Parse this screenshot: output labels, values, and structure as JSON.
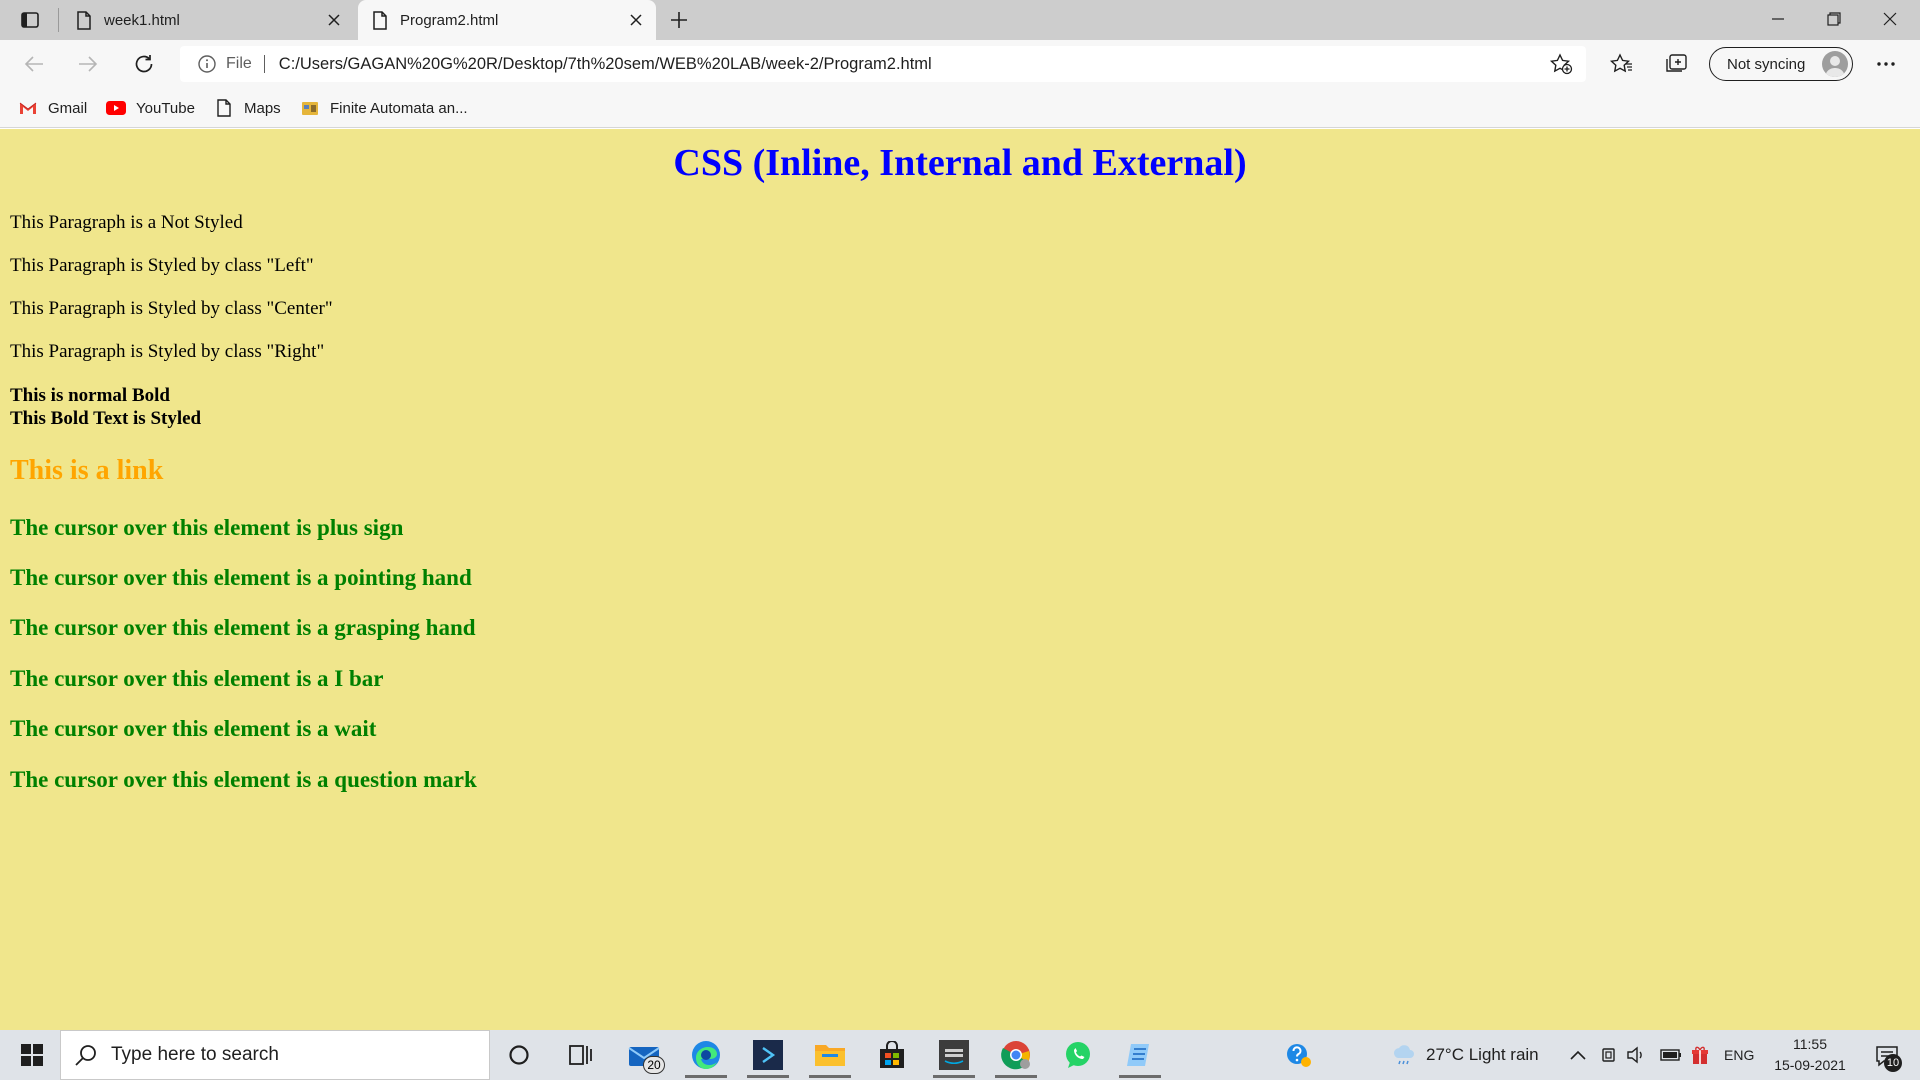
{
  "browser": {
    "tabs": [
      {
        "title": "week1.html",
        "active": false
      },
      {
        "title": "Program2.html",
        "active": true
      }
    ],
    "address": {
      "scheme_label": "File",
      "url": "C:/Users/GAGAN%20G%20R/Desktop/7th%20sem/WEB%20LAB/week-2/Program2.html"
    },
    "profile_label": "Not syncing",
    "favorites": [
      {
        "label": "Gmail",
        "icon": "gmail-icon"
      },
      {
        "label": "YouTube",
        "icon": "youtube-icon"
      },
      {
        "label": "Maps",
        "icon": "page-icon"
      },
      {
        "label": "Finite Automata an...",
        "icon": "site-icon"
      }
    ]
  },
  "page": {
    "title": "CSS (Inline, Internal and External)",
    "paragraphs": [
      "This Paragraph is a Not Styled",
      "This Paragraph is Styled by class \"Left\"",
      "This Paragraph is Styled by class \"Center\"",
      "This Paragraph is Styled by class \"Right\""
    ],
    "bold_lines": [
      "This is normal Bold",
      "This Bold Text is Styled"
    ],
    "link_text": "This is a link",
    "cursor_lines": [
      "The cursor over this element is plus sign",
      "The cursor over this element is a pointing hand",
      "The cursor over this element is a grasping hand",
      "The cursor over this element is a I bar",
      "The cursor over this element is a wait",
      "The cursor over this element is a question mark"
    ],
    "colors": {
      "background": "#f0e68c",
      "title": "#0000ff",
      "link": "#ffa500",
      "cursor_text": "#008000"
    }
  },
  "taskbar": {
    "search_placeholder": "Type here to search",
    "mail_badge": "20",
    "weather": "27°C  Light rain",
    "language": "ENG",
    "time": "11:55",
    "date": "15-09-2021",
    "notification_count": "10"
  }
}
